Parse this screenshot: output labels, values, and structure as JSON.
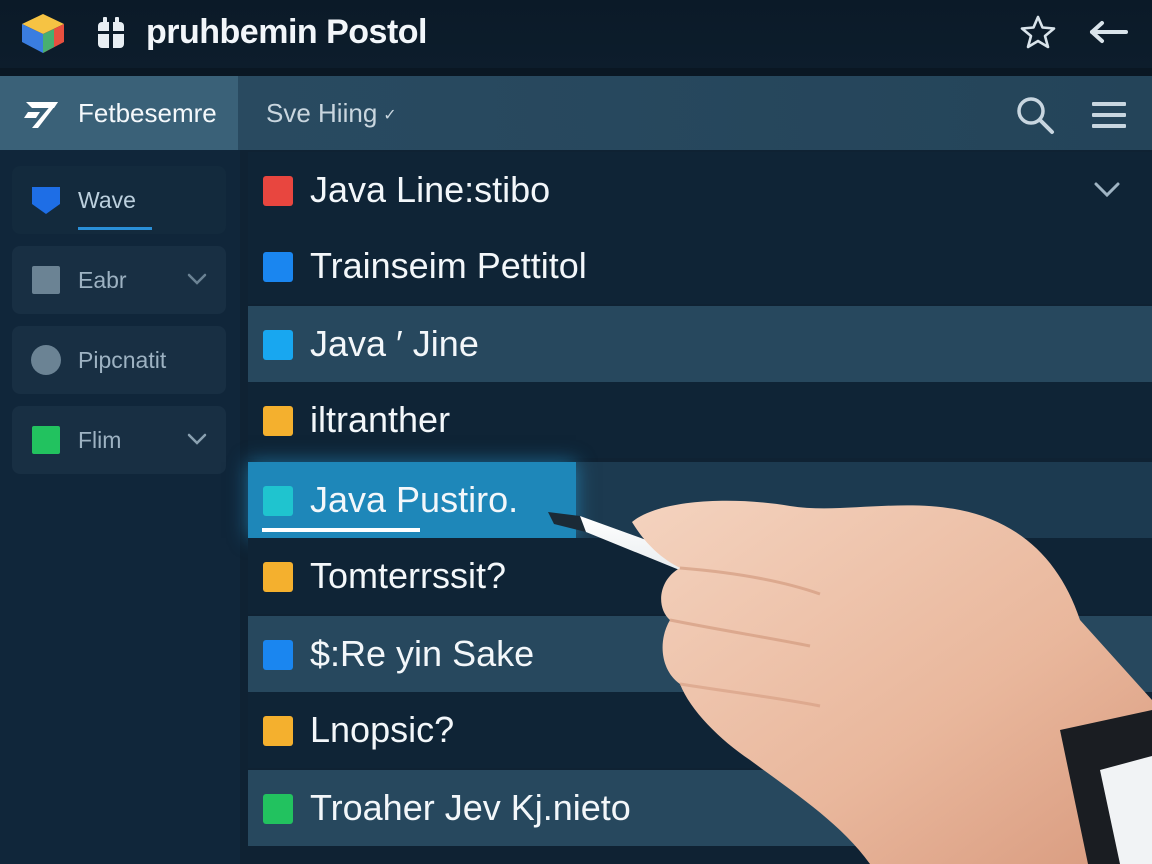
{
  "titlebar": {
    "title": "pruhbemin Postol",
    "icons": [
      "app-logo-icon",
      "document-icon",
      "star-icon",
      "back-arrow-icon"
    ]
  },
  "toolbar": {
    "brand_label": "Fetbesemre",
    "dropdown_label": "Sve Hiing",
    "dropdown_chevron": "✓",
    "icons": [
      "search-icon",
      "menu-icon"
    ]
  },
  "sidebar": {
    "items": [
      {
        "label": "Wave",
        "icon": "shield-icon",
        "color": "#1e6ee6",
        "active": true
      },
      {
        "label": "Eabr",
        "icon": "square-icon",
        "color": "#6b8394"
      },
      {
        "label": "Pipcnatit",
        "icon": "circle-icon",
        "color": "#6b8394"
      },
      {
        "label": "Flim",
        "icon": "square-icon",
        "color": "#22c25f"
      }
    ]
  },
  "list": {
    "rows": [
      {
        "label": "Java  Line:stibo",
        "color": "#e8463f"
      },
      {
        "label": "Trainseim Pettitol",
        "color": "#1a86f0"
      },
      {
        "label": "Java ′ Jine",
        "color": "#18a7f0"
      },
      {
        "label": "iltranther",
        "color": "#f4b02e"
      },
      {
        "label": "Java Pustiro.",
        "color": "#1fc4cf",
        "selected": true
      },
      {
        "label": "Tomterrssit?",
        "color": "#f4b02e"
      },
      {
        "label": "$:Re yin  Sake",
        "color": "#1a86f0"
      },
      {
        "label": "Lnopsiс?",
        "color": "#f4b02e"
      },
      {
        "label": "Troaher Jev Kj.nieto",
        "color": "#22c25f"
      }
    ]
  }
}
